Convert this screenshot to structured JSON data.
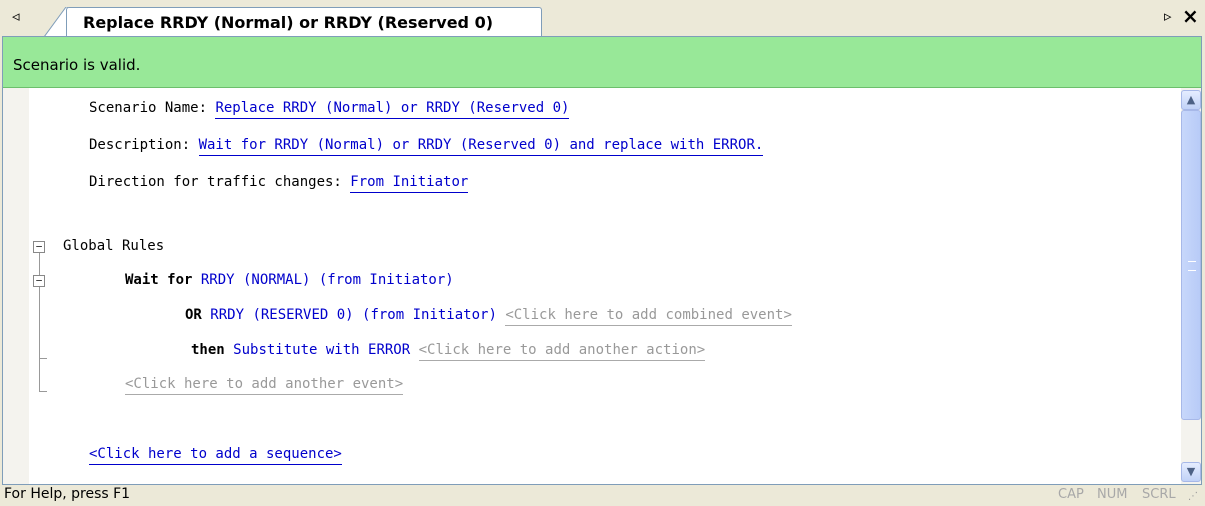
{
  "tabbar": {
    "nav_left": "◃",
    "tab_title": "Replace RRDY (Normal) or RRDY (Reserved 0)",
    "nav_right": "▹",
    "close": "×"
  },
  "status_message": "Scenario is valid.",
  "scenario": {
    "name_label": "Scenario Name: ",
    "name_value": "Replace RRDY (Normal) or RRDY (Reserved 0)",
    "description_label": "Description: ",
    "description_value": "Wait for RRDY (Normal) or RRDY (Reserved 0) and replace with ERROR.",
    "direction_label": "Direction for traffic changes: ",
    "direction_value": "From Initiator"
  },
  "rules": {
    "global_rules": "Global Rules",
    "wait_for": "Wait for ",
    "event1": "RRDY (NORMAL) (from Initiator)",
    "or": "OR ",
    "event2": "RRDY (RESERVED 0) (from Initiator)",
    "add_combined": "<Click here to add combined event>",
    "then": "then ",
    "action": "Substitute with ERROR",
    "add_action": "<Click here to add another action>",
    "add_event": "<Click here to add another event>",
    "add_sequence": "<Click here to add a sequence>"
  },
  "statusbar": {
    "help": "For Help, press F1",
    "cap": "CAP",
    "num": "NUM",
    "scrl": "SCRL"
  }
}
